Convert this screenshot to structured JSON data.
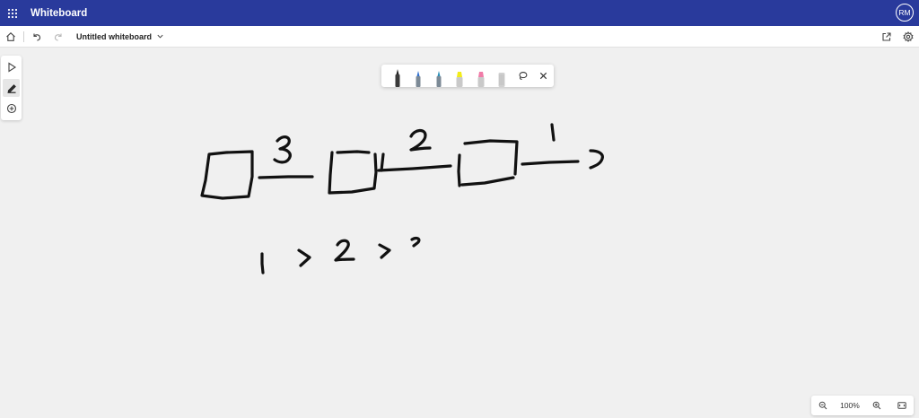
{
  "app": {
    "title": "Whiteboard",
    "user_initials": "RM",
    "brand_color": "#293a9c"
  },
  "toolbar": {
    "board_title": "Untitled whiteboard",
    "icons": [
      "home-icon",
      "undo-icon",
      "redo-icon",
      "chevron-down-icon",
      "share-icon",
      "settings-icon"
    ]
  },
  "left_rail": {
    "tools": [
      "select-icon",
      "ink-icon",
      "add-icon"
    ],
    "active_tool": "ink-icon"
  },
  "ink_toolbar": {
    "pens": [
      {
        "name": "black-pen",
        "color": "#222222"
      },
      {
        "name": "blue-pen",
        "color": "#2e6fd0"
      },
      {
        "name": "teal-pen",
        "color": "#2a8fb8"
      },
      {
        "name": "yellow-highlighter",
        "color": "#f2ec1a"
      },
      {
        "name": "pink-highlighter",
        "color": "#f07ca8"
      },
      {
        "name": "eraser",
        "color": "#d0d0d0"
      }
    ],
    "actions": [
      "lasso-icon",
      "close-icon"
    ]
  },
  "zoom": {
    "level": "100%",
    "icons": [
      "zoom-out-icon",
      "zoom-in-icon",
      "fit-to-screen-icon"
    ]
  }
}
